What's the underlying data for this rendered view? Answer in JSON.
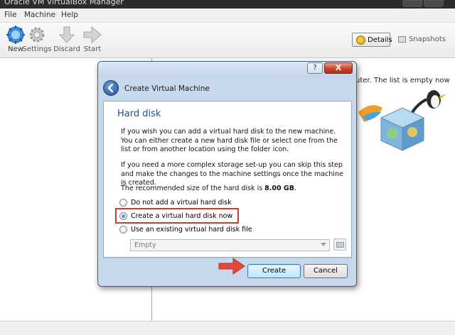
{
  "window": {
    "title": "Oracle VM VirtualBox Manager"
  },
  "menu": {
    "items": [
      "File",
      "Machine",
      "Help"
    ]
  },
  "toolbar": {
    "new_label": "New",
    "settings_label": "Settings",
    "discard_label": "Discard",
    "start_label": "Start",
    "details_label": "Details",
    "snapshots_label": "Snapshots"
  },
  "right_pane": {
    "welcome_text": "uter. The list is empty now"
  },
  "dialog": {
    "title": "Create Virtual Machine",
    "help_label": "?",
    "close_label": "X",
    "page_title": "Hard disk",
    "paragraph1": "If you wish you can add a virtual hard disk to the new machine. You can either create a new hard disk file or select one from the list or from another location using the folder icon.",
    "paragraph2": "If you need a more complex storage set-up you can skip this step and make the changes to the machine settings once the machine is created.",
    "recommended_prefix": "The recommended size of the hard disk is ",
    "recommended_size": "8.00 GB",
    "recommended_suffix": ".",
    "options": [
      {
        "label": "Do not add a virtual hard disk",
        "checked": false
      },
      {
        "label": "Create a virtual hard disk now",
        "checked": true
      },
      {
        "label": "Use an existing virtual hard disk file",
        "checked": false
      }
    ],
    "existing_disk_value": "Empty",
    "create_label": "Create",
    "cancel_label": "Cancel"
  },
  "colors": {
    "highlight_box": "#d23a2e",
    "annotation_arrow": "#e14b3b",
    "page_title": "#1d4f8e"
  }
}
